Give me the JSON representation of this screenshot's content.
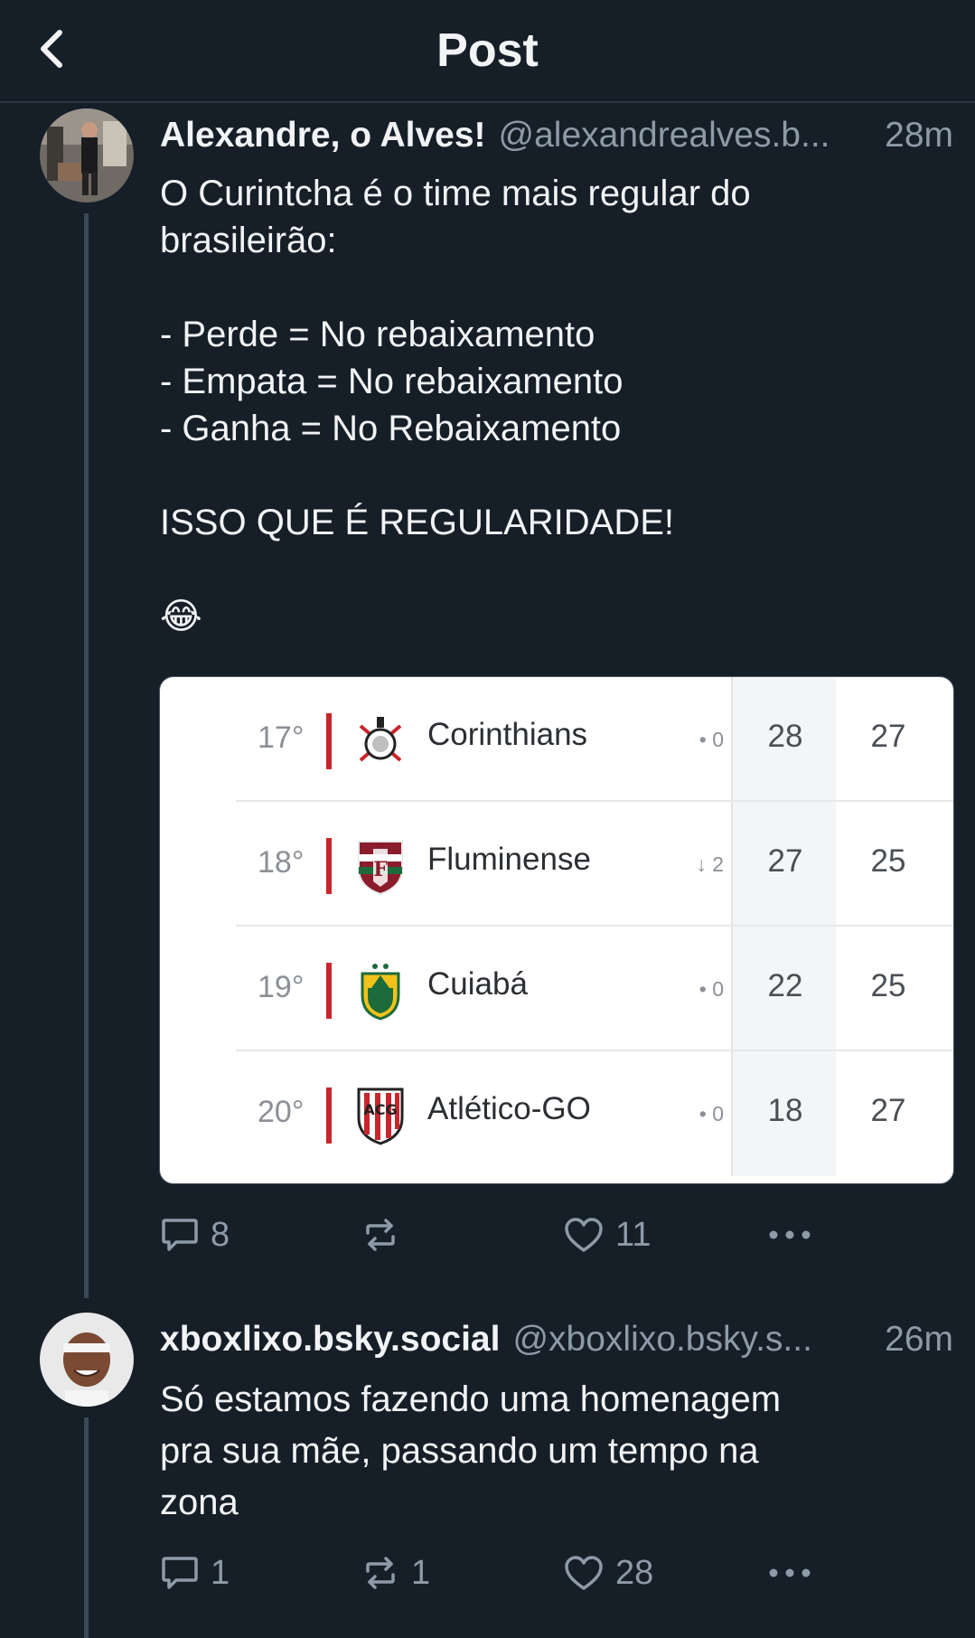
{
  "header": {
    "title": "Post"
  },
  "posts": [
    {
      "display_name": "Alexandre, o Alves!",
      "handle": "@alexandrealves.b...",
      "time": "28m",
      "text": "O Curintcha é o time mais regular do\nbrasileirão:\n\n- Perde = No rebaixamento\n- Empata = No rebaixamento\n- Ganha = No Rebaixamento\n\nISSO QUE É REGULARIDADE!\n\n😂",
      "embed": {
        "rows": [
          {
            "pos": "17°",
            "team": "Corinthians",
            "var": "• 0",
            "a": "28",
            "b": "27"
          },
          {
            "pos": "18°",
            "team": "Fluminense",
            "var": "↓ 2",
            "a": "27",
            "b": "25"
          },
          {
            "pos": "19°",
            "team": "Cuiabá",
            "var": "• 0",
            "a": "22",
            "b": "25"
          },
          {
            "pos": "20°",
            "team": "Atlético-GO",
            "var": "• 0",
            "a": "18",
            "b": "27"
          }
        ]
      },
      "counts": {
        "replies": "8",
        "reposts": "",
        "likes": "11"
      }
    },
    {
      "display_name": "xboxlixo.bsky.social",
      "handle": "@xboxlixo.bsky.s...",
      "time": "26m",
      "text": "Só estamos fazendo uma homenagem\npra sua mãe, passando um tempo na\nzona",
      "counts": {
        "replies": "1",
        "reposts": "1",
        "likes": "28"
      }
    }
  ],
  "colors": {
    "background": "#161e27",
    "muted": "#8d9aa8",
    "red": "#c9252c"
  }
}
